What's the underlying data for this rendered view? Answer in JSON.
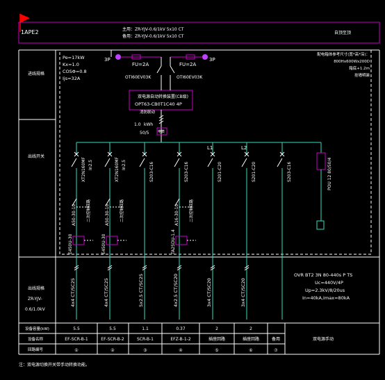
{
  "panel": {
    "id": "1APE2",
    "header_line1": "主用：ZR-YJV-0.6/1kV 5x10  CT",
    "header_line2": "备用：ZR-YJV-0.6/1kV 5x10  CT",
    "header_right": "自顶至顶"
  },
  "row_labels": {
    "incoming": "进线规格",
    "distribution": "出线开关",
    "outgoing_cable_a": "出线规格",
    "outgoing_cable_b": "ZR-YJV-",
    "outgoing_cable_c": "0.6/1.0kV"
  },
  "params": {
    "pe": "Pe=17kW",
    "kx": "Kx=1.0",
    "cos": "COSΦ=0.8",
    "ijs": "Ijs=32A"
  },
  "cabinet": {
    "line1": "配电箱体参考尺寸(宽*高*深)：",
    "line2": "800Hx600Wx200D",
    "line3": "箱底+1.2m",
    "line4": "挂墙明装"
  },
  "incomers": {
    "left_label": "3P",
    "right_label": "3P",
    "fuse_left": "FU=2A",
    "fuse_right": "FU=2A",
    "switch_left": "OTI60EV03K",
    "switch_right": "OTI60EV03K"
  },
  "ats": {
    "line1": "双电源自动转换装置(CB级)",
    "line2": "OPT63-CB0T1C40 4P",
    "note": "消防联动"
  },
  "meter": {
    "line1": "1.0",
    "line2": "kWh",
    "line3": "50/5",
    "box": "电表"
  },
  "phase_labels": {
    "l1": "L1",
    "l2": "L2"
  },
  "breakers": [
    {
      "model": "XT2N160MF",
      "rating": "In2.5"
    },
    {
      "model": "XT2N160MF",
      "rating": "In2.5"
    },
    {
      "model": "S203-C16",
      "rating": ""
    },
    {
      "model": "S203-C16",
      "rating": ""
    },
    {
      "model": "S201-C20",
      "rating": ""
    },
    {
      "model": "S201-C20",
      "rating": ""
    },
    {
      "model": "S203-C16",
      "rating": ""
    }
  ],
  "spd": "POU 12 80/50/4",
  "contactors": [
    {
      "model": "A50-30-10",
      "overload": "E450U-30",
      "aux": "二次控制回路"
    },
    {
      "model": "A50-30-10",
      "overload": "E450U-30",
      "aux": "二次控制回路"
    },
    {
      "model": "A16-30-10",
      "overload": "TA25DU-1.4",
      "aux": "二次控制回路"
    }
  ],
  "cables": [
    "4x4  CT/SC25",
    "4x4  CT/SC25",
    "5x2.5  CT/SC25",
    "4x2.5  CT/SC20",
    "3x4  CT/SC20",
    "3x4  CT/SC20"
  ],
  "surge": {
    "line1": "OVR BT2 3N 80-440s P TS",
    "line2": "Uc=440V/4P",
    "line3": "Up=2.3kV/8/20us",
    "line4": "In=40kA,Imax=80kA"
  },
  "table": {
    "row1_label": "设备容量(kW)",
    "row2_label": "设备名称",
    "row3_label": "回路编号",
    "power": [
      "5.5",
      "5.5",
      "1.1",
      "0.37",
      "2",
      "2",
      ""
    ],
    "names": [
      "EF-SCR-B-1",
      "EF-SCR-B-2",
      "SCR-B-1",
      "EFZ-B-1-2",
      "插座回路",
      "插座回路",
      "备用"
    ],
    "circuits": [
      "①",
      "②",
      "③",
      "④",
      "⑤",
      "⑥",
      "⑦"
    ],
    "merged": "双电源手动"
  },
  "footnote": "注：双电源切换开关带手动转换功能。",
  "colors": {
    "magenta": "#c800c8",
    "cyan": "#2fe0c0",
    "white": "#ffffff",
    "red": "#ff0000",
    "purple": "#c040ff"
  }
}
